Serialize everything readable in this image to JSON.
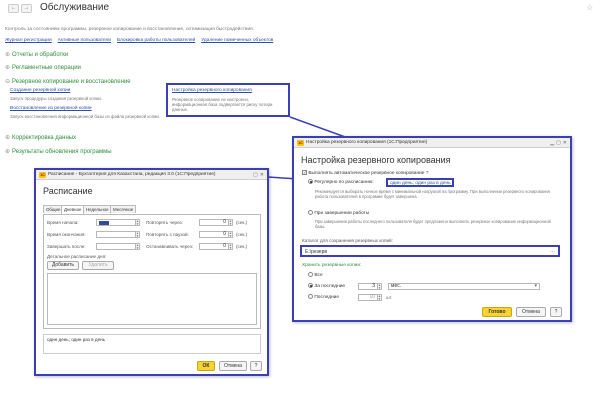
{
  "header": {
    "title": "Обслуживание",
    "back_label": "←",
    "forward_label": "→",
    "star_label": "☆",
    "description": "Контроль за состоянием программы, резервное копирование и восстановление, оптимизация быстродействия.",
    "links": [
      "Журнал регистрации",
      "Активные пользователи",
      "Блокировка работы пользователей",
      "Удаление помеченных объектов"
    ]
  },
  "sections": [
    {
      "label": "Отчеты и обработки",
      "arrow": "⊕"
    },
    {
      "label": "Регламентные операции",
      "arrow": "⊕"
    },
    {
      "label": "Резервное копирование и восстановление",
      "arrow": "⊖"
    },
    {
      "label": "Корректировка данных",
      "arrow": "⊕"
    },
    {
      "label": "Результаты обновления программы",
      "arrow": "⊕"
    }
  ],
  "backup_section": {
    "create_link": "Создание резервной копии",
    "create_desc": "Запуск процедуры создания резервной копии.",
    "restore_link": "Восстановление из резервной копии",
    "restore_desc": "Запуск восстановления информационной базы из файла резервной копии."
  },
  "callout": {
    "link": "Настройка резервного копирования",
    "text": "Резервное копирование не настроено, информационная база подвергается риску потери данных."
  },
  "schedule_window": {
    "title": "Расписание - Бухгалтерия для Казахстана, редакция 3.0 (1С:Предприятие)",
    "heading": "Расписание",
    "tabs": [
      "Общие",
      "Дневное",
      "Недельное",
      "Месячное"
    ],
    "start_label": "Время начала:",
    "end_label": "Время окончания:",
    "finish_after_label": "Завершать после:",
    "repeat_every_label": "Повторять через:",
    "repeat_pause_label": "Повторять с паузой:",
    "stop_after_label": "Останавливать через:",
    "zero": "0",
    "sec": "(сек.)",
    "detail_label": "Детальное расписание дня:",
    "add_label": "Добавить",
    "delete_label": "Удалить",
    "summary": "один день; один раз в день",
    "ok_label": "ОК",
    "cancel_label": "Отмена",
    "help_label": "?"
  },
  "backup_window": {
    "title": "Настройка резервного копирования (1С:Предприятие)",
    "heading": "Настройка резервного копирования",
    "auto_label": "Выполнять автоматическое резервное копирование",
    "help_mark": "?",
    "regular_label": "Регулярно по расписанию:",
    "schedule_link": "один день; один раз в день",
    "regular_desc": "Рекомендуется выбирать ночное время с минимальной нагрузкой на программу. При выполнении резервного копирования работа пользователей в программе будет завершена.",
    "on_exit_label": "При завершении работы",
    "on_exit_desc": "При завершении работы последнего пользователя будет предложено выполнить резервное копирование информационной базы.",
    "dir_label": "Каталог для сохранения резервных копий:",
    "dir_value": "E:\\резерв",
    "keep_label": "Хранить резервные копии:",
    "all_label": "Все",
    "last_label": "За последние",
    "last_value": "3",
    "last_unit": "мес.",
    "count_label": "Последние",
    "count_value": "10",
    "count_unit": "шт.",
    "ready_label": "Готово",
    "cancel_label": "Отмена",
    "help_label": "?"
  },
  "colors": {
    "accent": "#3b3fb5",
    "link": "#2b4ea8",
    "section": "#2f8d3a",
    "ok": "#f7d335"
  }
}
